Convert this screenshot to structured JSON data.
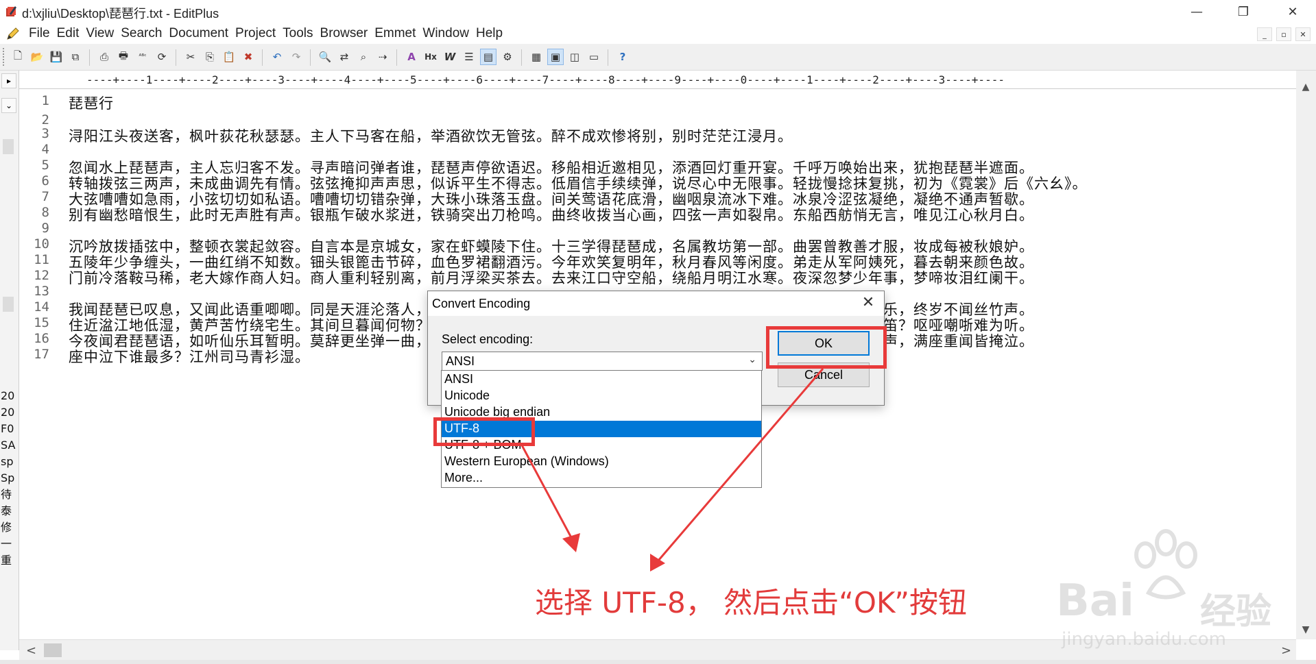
{
  "window": {
    "title": "d:\\xjliu\\Desktop\\琵琶行.txt - EditPlus",
    "minimize": "—",
    "restore": "❐",
    "close": "✕"
  },
  "menu": {
    "items": [
      "File",
      "Edit",
      "View",
      "Search",
      "Document",
      "Project",
      "Tools",
      "Browser",
      "Emmet",
      "Window",
      "Help"
    ],
    "mdi": [
      "_",
      "▫",
      "✕"
    ]
  },
  "toolbar": {
    "icons": [
      "new-file-icon",
      "open-folder-icon",
      "save-icon",
      "save-all-icon",
      "print-preview-icon",
      "print-icon",
      "spell-check-icon",
      "refresh-icon",
      "cut-icon",
      "copy-icon",
      "paste-icon",
      "delete-icon",
      "undo-icon",
      "redo-icon",
      "find-icon",
      "replace-icon",
      "find-in-files-icon",
      "goto-line-icon",
      "font-icon",
      "hex-icon",
      "word-wrap-icon",
      "line-numbers-icon",
      "column-select-icon",
      "settings-icon",
      "browser-icon",
      "user-tool-icon",
      "preview-icon",
      "monitor-icon",
      "help-cursor-icon"
    ],
    "glyphs": [
      "🗋",
      "📂",
      "💾",
      "⧉",
      "⎙",
      "🖶",
      "ᴬᴮᶜ",
      "⟳",
      "✂",
      "⎘",
      "📋",
      "✖",
      "↶",
      "↷",
      "🔍",
      "⇄",
      "⌕",
      "⇢",
      "A",
      "Hx",
      "W",
      "☰",
      "▤",
      "⚙",
      "▦",
      "▣",
      "◫",
      "▭",
      "?"
    ]
  },
  "left_panel": {
    "items": [
      "20",
      "20",
      "F0",
      "SA",
      "sp",
      "Sp",
      "待",
      "泰",
      "修",
      "一",
      "重"
    ]
  },
  "ruler": {
    "text": "----+----1----+----2----+----3----+----4----+----5----+----6----+----7----+----8----+----9----+----0----+----1----+----2----+----3----+----"
  },
  "editor": {
    "lines": [
      {
        "n": "1",
        "text": " 琵琶行"
      },
      {
        "n": "2",
        "text": ""
      },
      {
        "n": "3",
        "text": " 浔阳江头夜送客，枫叶荻花秋瑟瑟。主人下马客在船，举酒欲饮无管弦。醉不成欢惨将别，别时茫茫江浸月。"
      },
      {
        "n": "4",
        "text": ""
      },
      {
        "n": "5",
        "text": "忽闻水上琵琶声，主人忘归客不发。寻声暗问弹者谁，琵琶声停欲语迟。移船相近邀相见，添酒回灯重开宴。千呼万唤始出来，犹抱琵琶半遮面。"
      },
      {
        "n": "6",
        "text": "转轴拨弦三两声，未成曲调先有情。弦弦掩抑声声思，似诉平生不得志。低眉信手续续弹，说尽心中无限事。轻拢慢捻抹复挑，初为《霓裳》后《六幺》。"
      },
      {
        "n": "7",
        "text": "大弦嘈嘈如急雨，小弦切切如私语。嘈嘈切切错杂弹，大珠小珠落玉盘。间关莺语花底滑，幽咽泉流冰下难。冰泉冷涩弦凝绝，凝绝不通声暂歇。"
      },
      {
        "n": "8",
        "text": "别有幽愁暗恨生，此时无声胜有声。银瓶乍破水浆迸，铁骑突出刀枪鸣。曲终收拨当心画，四弦一声如裂帛。东船西舫悄无言，唯见江心秋月白。"
      },
      {
        "n": "9",
        "text": ""
      },
      {
        "n": "10",
        "text": "沉吟放拨插弦中，整顿衣裳起敛容。自言本是京城女，家在虾蟆陵下住。十三学得琵琶成，名属教坊第一部。曲罢曾教善才服，妆成每被秋娘妒。"
      },
      {
        "n": "11",
        "text": "五陵年少争缠头，一曲红绡不知数。钿头银篦击节碎，血色罗裙翻酒污。今年欢笑复明年，秋月春风等闲度。弟走从军阿姨死，暮去朝来颜色故。"
      },
      {
        "n": "12",
        "text": "门前冷落鞍马稀，老大嫁作商人妇。商人重利轻别离，前月浮梁买茶去。去来江口守空船，绕船月明江水寒。夜深忽梦少年事，梦啼妆泪红阑干。"
      },
      {
        "n": "13",
        "text": ""
      },
      {
        "n": "14",
        "text": "我闻琵琶已叹息，又闻此语重唧唧。同是天涯沦落人，相逢何必曾相识！我从去年辞帝京，谪居卧病浔阳城。浔阳地僻无音乐，终岁不闻丝竹声。"
      },
      {
        "n": "15",
        "text": "住近湓江地低湿，黄芦苦竹绕宅生。其间旦暮闻何物？杜鹃啼血猿哀鸣。春江花朝秋月夜，往往取酒还独倾。岂无山歌与村笛？呕哑嘲哳难为听。"
      },
      {
        "n": "16",
        "text": "今夜闻君琵琶语，如听仙乐耳暂明。莫辞更坐弹一曲，为君翻作琵琶行。感我此言良久立，却坐促弦弦转急。凄凄不似向前声，满座重闻皆掩泣。"
      },
      {
        "n": "17",
        "text": "座中泣下谁最多？江州司马青衫湿。"
      }
    ]
  },
  "dialog": {
    "title": "Convert Encoding",
    "close": "✕",
    "label": "Select encoding:",
    "selected_value": "ANSI",
    "ok_label": "OK",
    "cancel_label": "Cancel",
    "options": [
      "ANSI",
      "Unicode",
      "Unicode big endian",
      "UTF-8",
      "UTF-8 + BOM",
      "Western European (Windows)",
      "More..."
    ],
    "highlighted_option": "UTF-8"
  },
  "annotation": {
    "text": "选择 UTF-8， 然后点击“OK”按钮",
    "color": "#e23b3b"
  },
  "watermark": {
    "brand": "Bai",
    "brand2": "经验",
    "url": "jingyan.baidu.com"
  },
  "scroll": {
    "up": "▲",
    "down": "▼",
    "left": "<",
    "right": ">"
  }
}
